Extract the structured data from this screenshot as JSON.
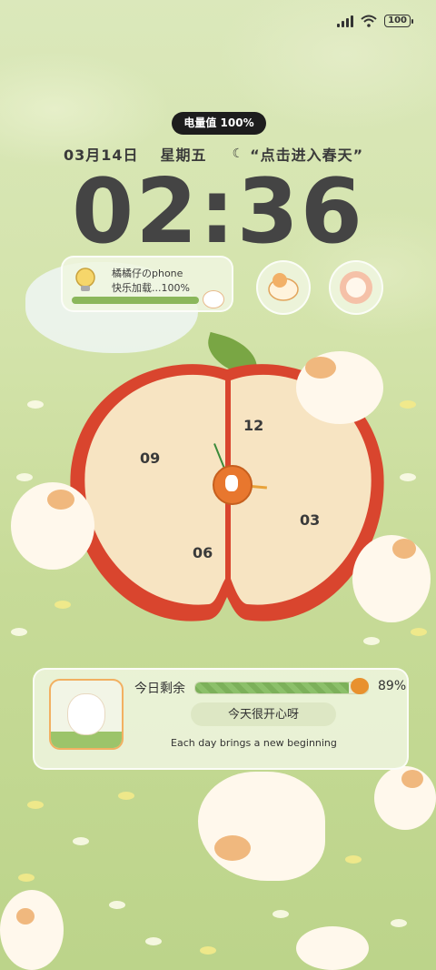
{
  "status_bar": {
    "battery": "100"
  },
  "lockscreen": {
    "battery_pill": "电量值 100%",
    "date": "03月14日",
    "weekday": "星期五",
    "caption": "“点击进入春天”",
    "time": "02:36"
  },
  "progress_widget": {
    "line1": "橘橘仔のphone",
    "line2": "快乐加载...100%",
    "progress": 1.0
  },
  "clock_face": {
    "numbers": [
      "12",
      "03",
      "06",
      "09"
    ]
  },
  "bottom_widget": {
    "label": "今日剩余",
    "percent_text": "89%",
    "progress": 0.89,
    "button_label": "今天很开心呀",
    "quote": "Each day brings a new beginning"
  },
  "colors": {
    "accent_green": "#8bb75b",
    "apple_red": "#d9452e",
    "orange": "#e8772e"
  },
  "icons": [
    "signal-icon",
    "wifi-icon",
    "battery-icon",
    "lightbulb-icon",
    "apple-clock",
    "cat-sticker"
  ]
}
